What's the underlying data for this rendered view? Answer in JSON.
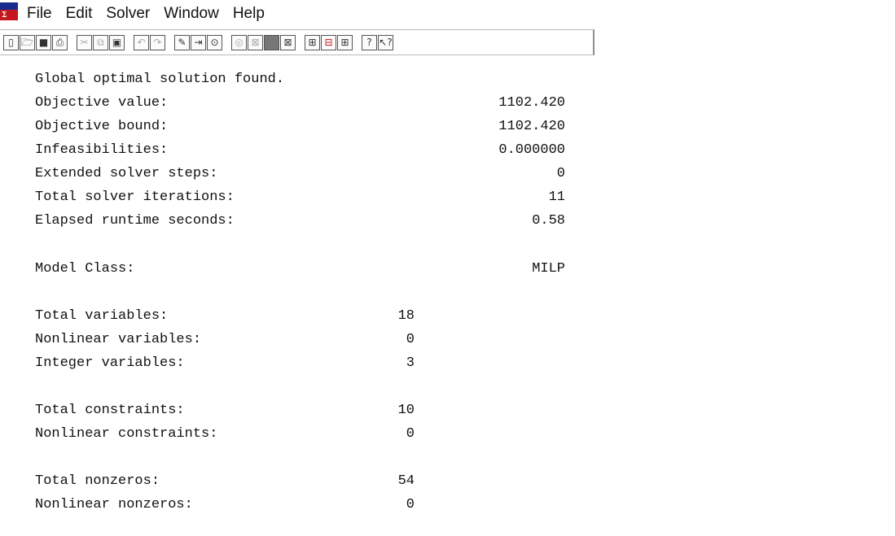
{
  "menubar": {
    "items": [
      "File",
      "Edit",
      "Solver",
      "Window",
      "Help"
    ]
  },
  "toolbar": {
    "buttons": [
      "new-icon",
      "open-icon",
      "save-icon",
      "print-icon",
      "cut-icon",
      "copy-icon",
      "paste-icon",
      "undo-icon",
      "redo-icon",
      "find-icon",
      "go-to-line-icon",
      "match-parenthesis-icon",
      "solve-icon",
      "solution-icon",
      "send-to-back-icon",
      "close-all-icon",
      "tile-icon",
      "cascade-icon",
      "options-icon",
      "help-icon",
      "context-help-icon"
    ]
  },
  "report": {
    "status": "Global optimal solution found.",
    "objective_value": {
      "label": "Objective value:",
      "value": "1102.420"
    },
    "objective_bound": {
      "label": "Objective bound:",
      "value": "1102.420"
    },
    "infeasibilities": {
      "label": "Infeasibilities:",
      "value": "0.000000"
    },
    "extended_steps": {
      "label": "Extended solver steps:",
      "value": "0"
    },
    "iterations": {
      "label": "Total solver iterations:",
      "value": "11"
    },
    "runtime": {
      "label": "Elapsed runtime seconds:",
      "value": "0.58"
    },
    "model_class": {
      "label": "Model Class:",
      "value": "MILP"
    },
    "total_variables": {
      "label": "Total variables:",
      "value": "18"
    },
    "nonlinear_variables": {
      "label": "Nonlinear variables:",
      "value": "0"
    },
    "integer_variables": {
      "label": "Integer variables:",
      "value": "3"
    },
    "total_constraints": {
      "label": "Total constraints:",
      "value": "10"
    },
    "nonlinear_constraints": {
      "label": "Nonlinear constraints:",
      "value": "0"
    },
    "total_nonzeros": {
      "label": "Total nonzeros:",
      "value": "54"
    },
    "nonlinear_nonzeros": {
      "label": "Nonlinear nonzeros:",
      "value": "0"
    }
  }
}
